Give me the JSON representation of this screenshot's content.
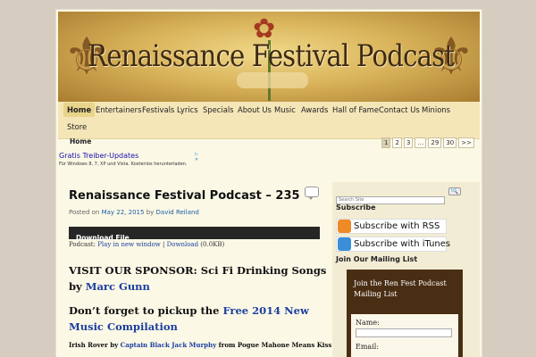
{
  "site": {
    "banner_title": "Renaissance Festival Podcast"
  },
  "nav": {
    "items": [
      {
        "label": "Home",
        "active": true
      },
      {
        "label": "Entertainers"
      },
      {
        "label": "Festivals"
      },
      {
        "label": "Lyrics"
      },
      {
        "label": "Specials"
      },
      {
        "label": "About Us"
      },
      {
        "label": "Music"
      },
      {
        "label": "Awards"
      },
      {
        "label": "Hall of Fame"
      },
      {
        "label": "Contact Us"
      },
      {
        "label": "Minions"
      },
      {
        "label": "Store"
      }
    ]
  },
  "breadcrumb": "Home",
  "pager": [
    "1",
    "2",
    "3",
    "…",
    "29",
    "30",
    ">>"
  ],
  "ad": {
    "title": "Gratis Treiber-Updates",
    "text": "Für Windows 8, 7, XP und Vista. Kostenlos herunterladen.",
    "icons": "▷ ✕"
  },
  "post": {
    "title": "Renaissance Festival Podcast – 235",
    "posted_on": "Posted on",
    "date": "May 22, 2015",
    "by": "by",
    "author": "David Reiland",
    "player_label": "Download File",
    "podcast_prefix": "Podcast:",
    "play_new_window": "Play in new window",
    "separator": "|",
    "download": "Download",
    "size": "(0.0KB)",
    "sponsor_prefix": "VISIT OUR SPONSOR: Sci Fi Drinking Songs by",
    "sponsor_link": "Marc Gunn",
    "promo_prefix": "Don’t forget to pickup the",
    "promo_link": "Free 2014 New Music Compilation",
    "song_title": "Irish Rover by",
    "song_artist": "Captain Black Jack Murphy",
    "song_suffix": "from Pogue Mahone Means Kiss My"
  },
  "sidebar": {
    "search_placeholder": "Search Site",
    "search_button": "🔍",
    "subscribe_heading": "Subscribe",
    "rss_label": "Subscribe with RSS",
    "itunes_label": "Subscribe with iTunes",
    "mailing_heading": "Join Our Mailing List",
    "mailing_box_title": "Join the Ren Fest Podcast Mailing List",
    "name_label": "Name:",
    "email_label": "Email:"
  },
  "colors": {
    "page_bg": "#d6ccc0",
    "content_bg": "#fbf8e6",
    "nav_bg": "#f5e6b8",
    "link": "#1b3fa0",
    "mail_box": "#4a2e14"
  }
}
